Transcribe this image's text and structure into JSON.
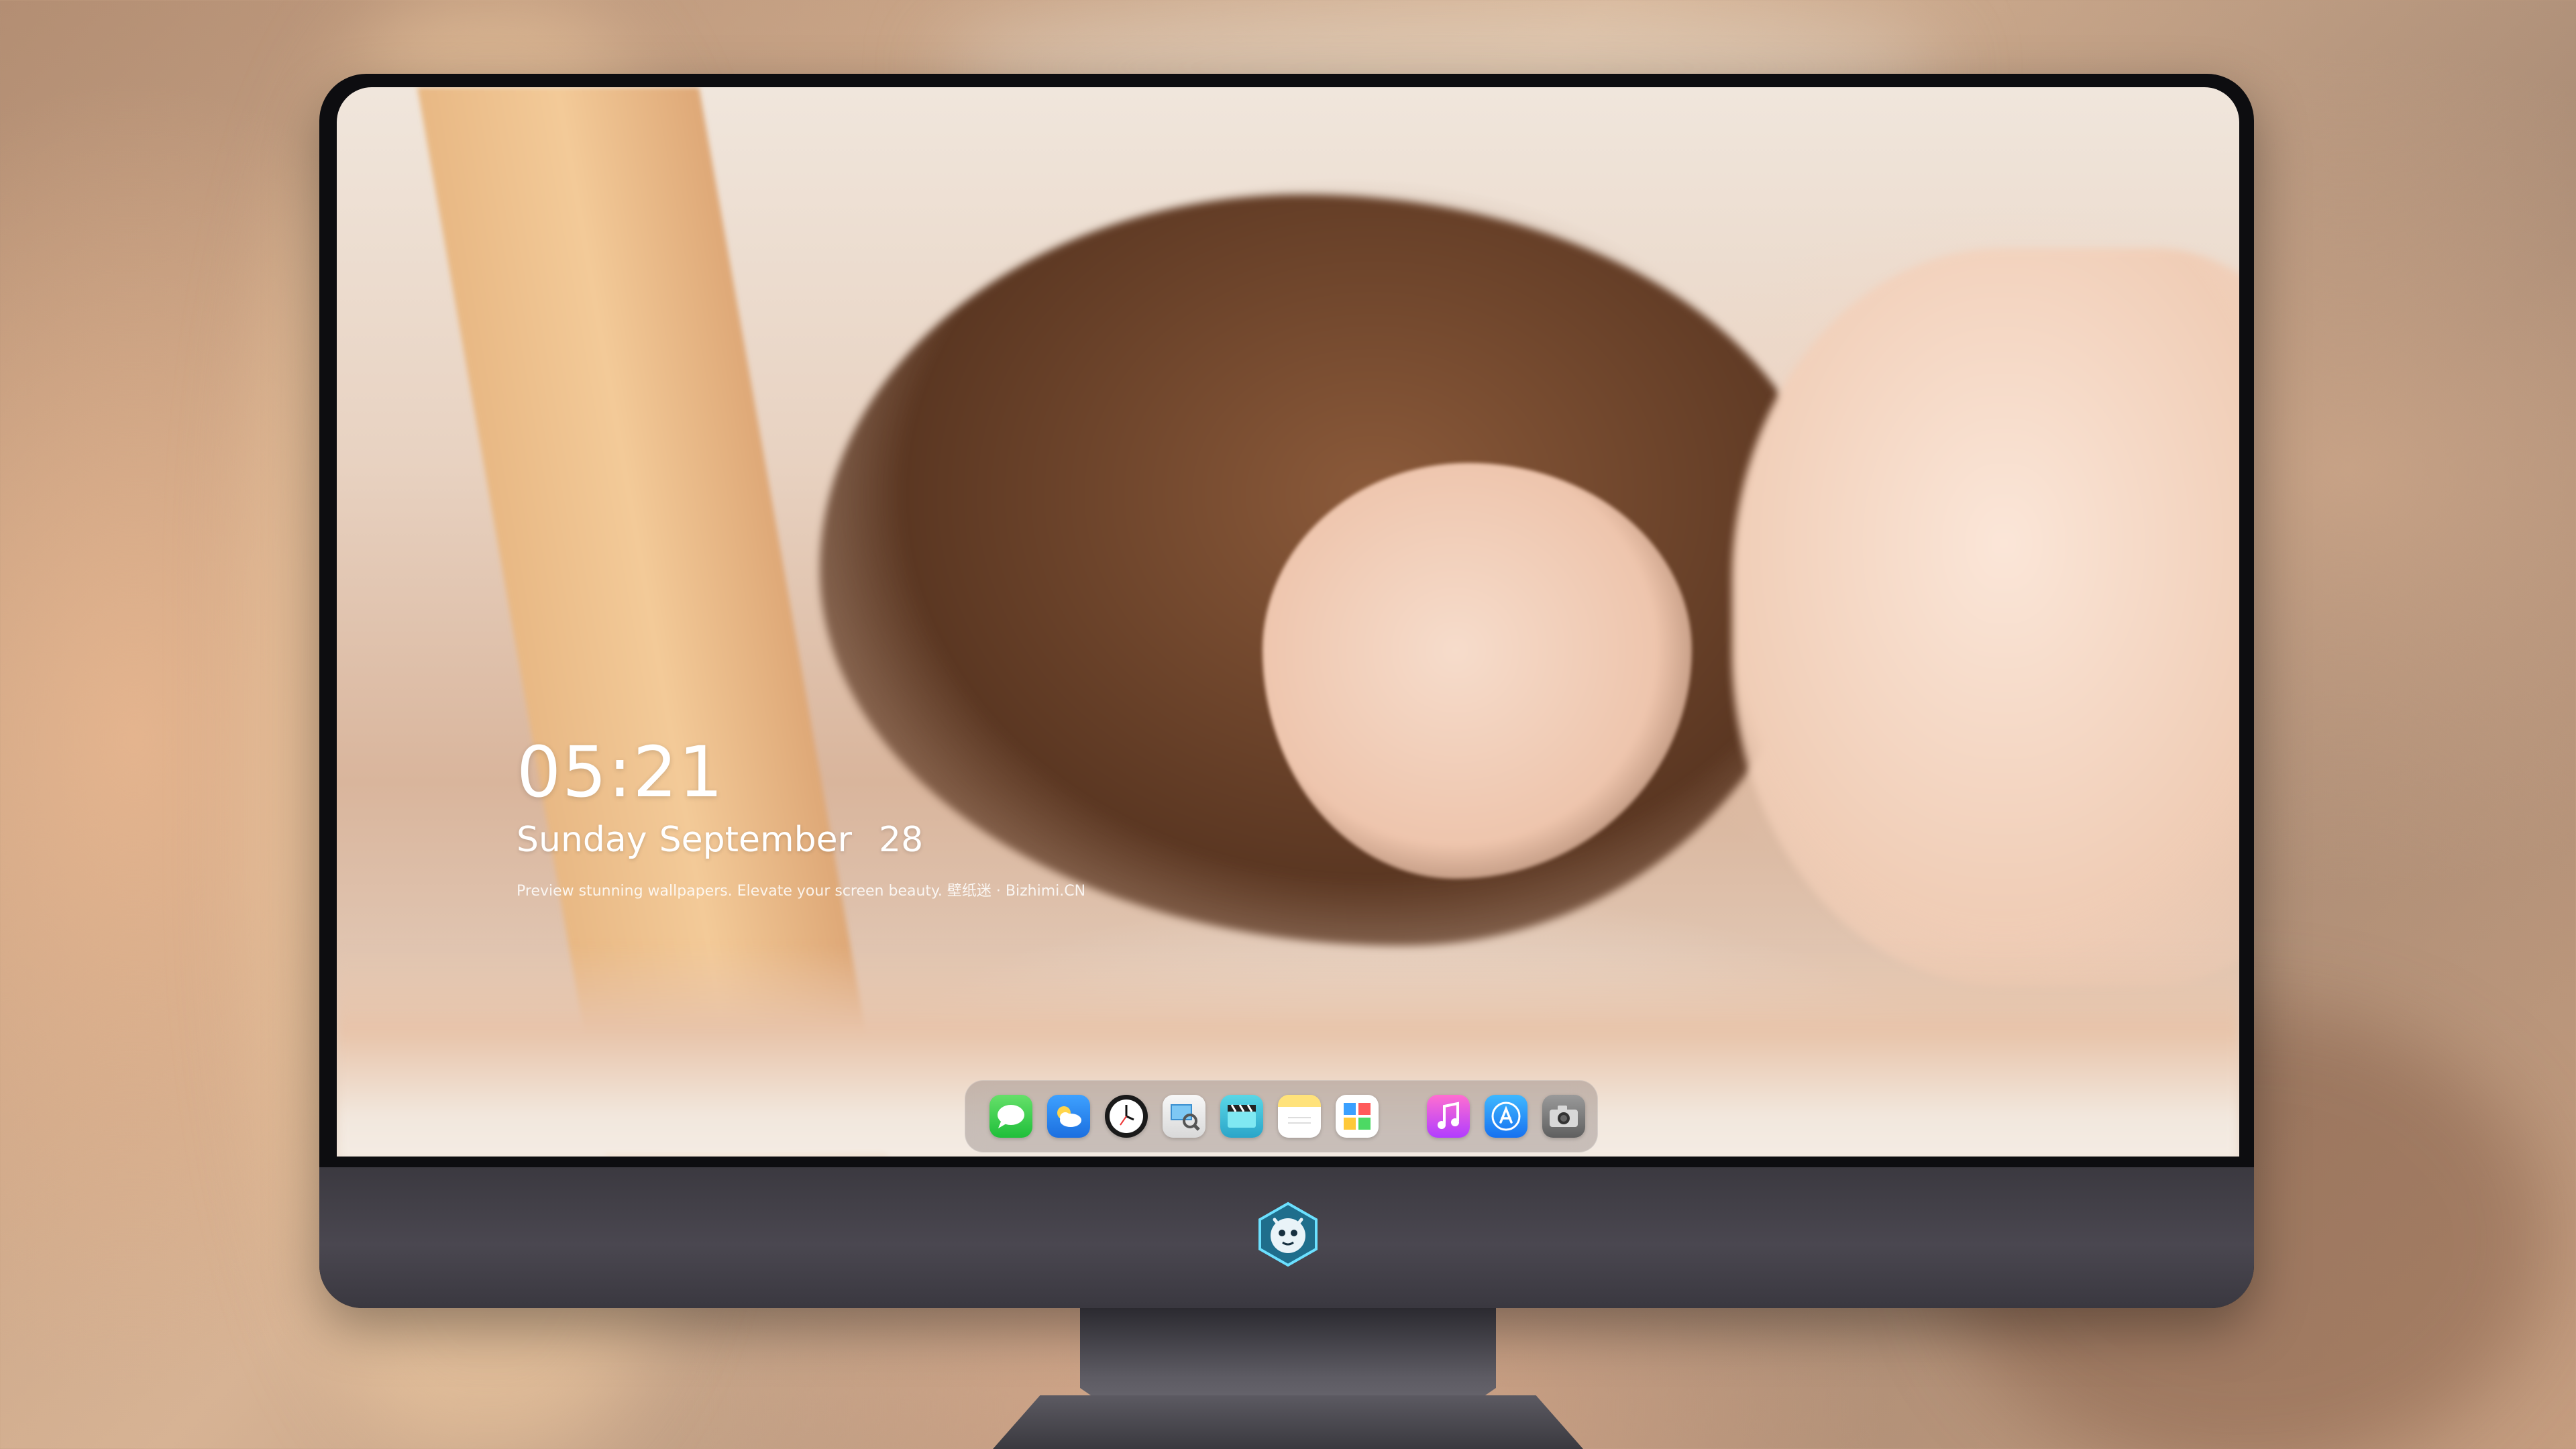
{
  "lockscreen": {
    "time": "05:21",
    "weekday": "Sunday",
    "month": "September",
    "day": "28",
    "tagline": "Preview stunning wallpapers. Elevate your screen beauty. 壁纸迷 · Bizhimi.CN"
  },
  "dock": {
    "apps": [
      {
        "name": "messages-icon",
        "color": "#22c33f"
      },
      {
        "name": "weather-icon",
        "color": "#2a86f0"
      },
      {
        "name": "clock-icon",
        "color": "#1a1a1a"
      },
      {
        "name": "preview-icon",
        "color": "#e4e4e4"
      },
      {
        "name": "claquette-icon",
        "color": "#3bbfd6"
      },
      {
        "name": "notes-icon",
        "color": "#ffe27a"
      },
      {
        "name": "photos-icon",
        "color": "#ffffff"
      },
      {
        "name": "music-icon",
        "color": "#d04fe8"
      },
      {
        "name": "app-store-icon",
        "color": "#2a8cf4"
      },
      {
        "name": "camera-icon",
        "color": "#7a7a7a"
      }
    ]
  },
  "monitor": {
    "chin_logo": "dragon-mascot-logo"
  }
}
